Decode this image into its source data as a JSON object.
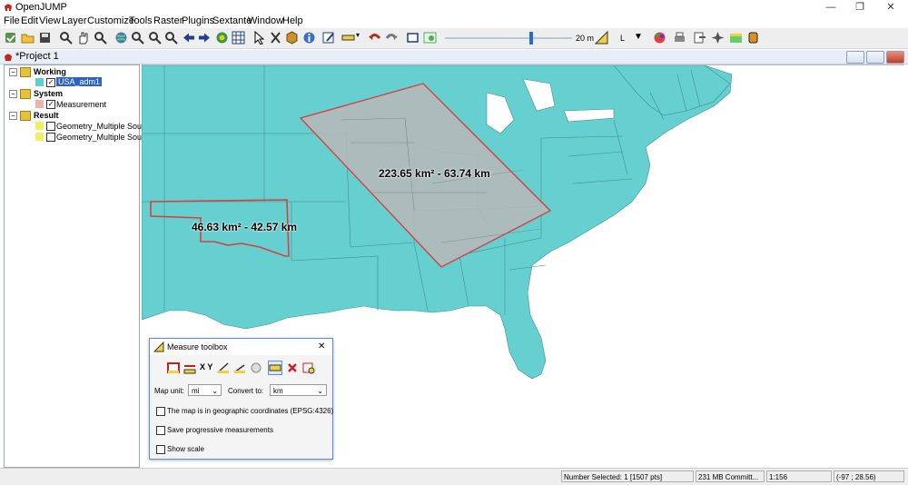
{
  "window": {
    "title": "OpenJUMP",
    "minimize_glyph": "—",
    "restore_glyph": "❐",
    "close_glyph": "✕"
  },
  "menu": [
    "File",
    "Edit",
    "View",
    "Layer",
    "Customize",
    "Tools",
    "Raster",
    "Plugins",
    "Sextante",
    "Window",
    "Help"
  ],
  "toolbar": {
    "scale_value": "20 m",
    "label_L": "L",
    "icons": [
      "new-project-icon",
      "open-folder-icon",
      "save-icon",
      "zoom-icon",
      "pan-hand-icon",
      "zoom-previous-icon",
      "globe-icon",
      "zoom-in-icon",
      "zoom-out-icon",
      "zoom-extent-icon",
      "back-arrow-icon",
      "forward-arrow-icon",
      "layers-icon",
      "grid-icon",
      "select-arrow-icon",
      "scissors-icon",
      "package-icon",
      "info-icon",
      "edit-pencil-icon",
      "ruler-icon",
      "undo-icon",
      "redo-icon",
      "window-icon",
      "image-icon",
      "measure-icon",
      "palette-icon",
      "print-icon",
      "export-icon",
      "star-icon",
      "wms-icon",
      "database-icon"
    ]
  },
  "project": {
    "title": "*Project 1"
  },
  "tree": {
    "categories": [
      {
        "name": "Working",
        "layers": [
          {
            "name": "USA_adm1",
            "checked": true,
            "selected": true,
            "color": "#60cfd0"
          }
        ]
      },
      {
        "name": "System",
        "layers": [
          {
            "name": "Measurement",
            "checked": true,
            "selected": false,
            "color": "#f0b0b0"
          }
        ]
      },
      {
        "name": "Result",
        "layers": [
          {
            "name": "Geometry_Multiple Source",
            "checked": false,
            "selected": false,
            "color": "#f0f060"
          },
          {
            "name": "Geometry_Multiple Source",
            "checked": false,
            "selected": false,
            "color": "#f0f060"
          }
        ]
      }
    ]
  },
  "map": {
    "land_color": "#66cfcf",
    "measure_fill": "#b8b8b8",
    "measure_stroke": "#d84040",
    "label_large": "223.65 km² - 63.74 km",
    "label_small": "46.63 km² - 42.57 km"
  },
  "toolbox": {
    "title": "Measure toolbox",
    "close_glyph": "✕",
    "map_unit_label": "Map unit:",
    "map_unit_value": "mi",
    "convert_label": "Convert to:",
    "convert_value": "km",
    "xy_label": "X Y",
    "chk_geographic": "The map is in geographic coordinates (EPSG:4326)",
    "chk_progressive": "Save progressive measurements",
    "chk_scale": "Show scale"
  },
  "status": {
    "selected": "Number Selected: 1 [1507 pts]",
    "memory": "231 MB Committ...",
    "scale": "1:156",
    "coords": "(-97 ; 28.56)"
  }
}
